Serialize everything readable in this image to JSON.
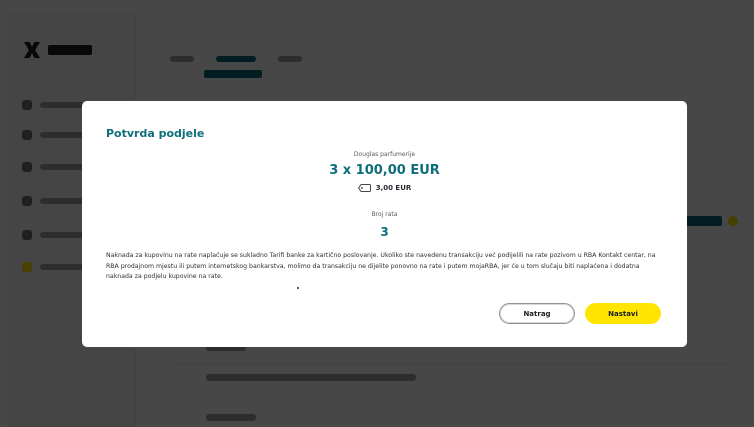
{
  "modal": {
    "title": "Potvrda podjele",
    "merchant": "Douglas parfumerije",
    "amount": "3 x 100,00 EUR",
    "fee": "3,00 EUR",
    "installments_label": "Broj rata",
    "installments_value": "3",
    "notice": "Naknada za kupovinu na rate naplaćuje se sukladno Tarifi banke za kartično poslovanje. Ukoliko ste navedenu transakciju već podijelili na rate pozivom u RBA Kontakt centar, na RBA prodajnom mjestu ili putem internetskog bankarstva, molimo da transakciju ne dijelite ponovno na rate i putem mojaRBA, jer će u tom slučaju biti naplaćena i dodatna naknada za podjelu kupovine na rate.",
    "back_label": "Natrag",
    "continue_label": "Nastavi"
  },
  "icons": {
    "fee": "price-tag-icon",
    "brand": "rba-logo-icon"
  },
  "colors": {
    "accent": "#0e6e7b",
    "primary_button": "#ffe500",
    "overlay": "rgba(0,0,0,0.72)"
  }
}
